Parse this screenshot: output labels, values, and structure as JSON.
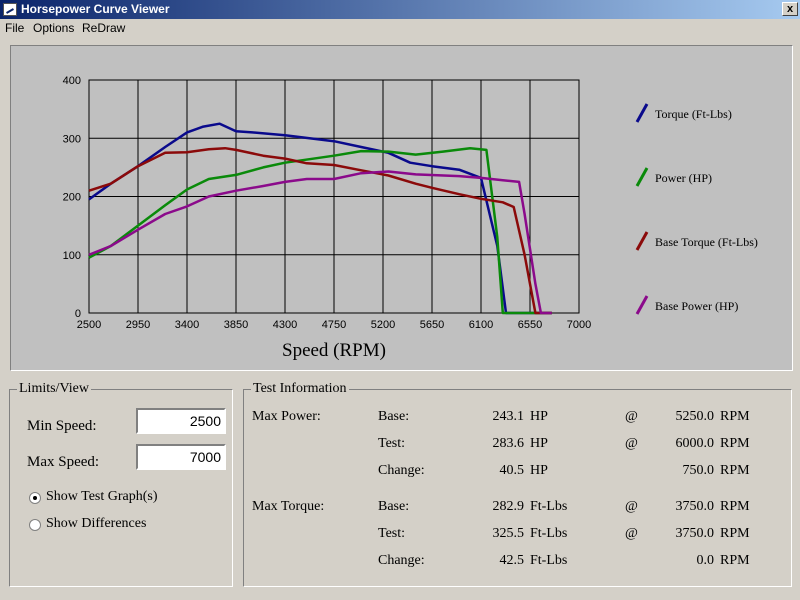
{
  "window": {
    "title": "Horsepower Curve Viewer",
    "close_label": "x"
  },
  "menu": [
    "File",
    "Options",
    "ReDraw"
  ],
  "chart_data": {
    "type": "line",
    "xlabel": "Speed (RPM)",
    "ylabel": "",
    "xlim": [
      2500,
      7000
    ],
    "ylim": [
      0,
      400
    ],
    "x_ticks": [
      2500,
      2950,
      3400,
      3850,
      4300,
      4750,
      5200,
      5650,
      6100,
      6550,
      7000
    ],
    "y_ticks": [
      0,
      100,
      200,
      300,
      400
    ],
    "grid": true,
    "legend_position": "right",
    "series": [
      {
        "name": "Torque (Ft-Lbs)",
        "color": "#0a0a8c",
        "points": [
          [
            2500,
            195
          ],
          [
            2700,
            222
          ],
          [
            2950,
            252
          ],
          [
            3200,
            285
          ],
          [
            3400,
            310
          ],
          [
            3550,
            320
          ],
          [
            3700,
            325
          ],
          [
            3850,
            312
          ],
          [
            4000,
            310
          ],
          [
            4300,
            305
          ],
          [
            4750,
            295
          ],
          [
            5000,
            285
          ],
          [
            5250,
            275
          ],
          [
            5450,
            258
          ],
          [
            5650,
            252
          ],
          [
            5900,
            246
          ],
          [
            6100,
            232
          ],
          [
            6250,
            115
          ],
          [
            6330,
            0
          ],
          [
            6550,
            0
          ],
          [
            6750,
            0
          ]
        ]
      },
      {
        "name": "Power (HP)",
        "color": "#0a8a0a",
        "points": [
          [
            2500,
            95
          ],
          [
            2700,
            115
          ],
          [
            2950,
            150
          ],
          [
            3200,
            185
          ],
          [
            3400,
            212
          ],
          [
            3600,
            230
          ],
          [
            3850,
            237
          ],
          [
            4100,
            250
          ],
          [
            4300,
            258
          ],
          [
            4750,
            270
          ],
          [
            5000,
            278
          ],
          [
            5250,
            277
          ],
          [
            5500,
            272
          ],
          [
            5750,
            277
          ],
          [
            6000,
            283
          ],
          [
            6150,
            280
          ],
          [
            6250,
            130
          ],
          [
            6300,
            0
          ],
          [
            6550,
            0
          ],
          [
            6750,
            0
          ]
        ]
      },
      {
        "name": "Base Torque (Ft-Lbs)",
        "color": "#8b0a0a",
        "points": [
          [
            2500,
            210
          ],
          [
            2700,
            222
          ],
          [
            2950,
            252
          ],
          [
            3200,
            275
          ],
          [
            3400,
            276
          ],
          [
            3600,
            281
          ],
          [
            3750,
            283
          ],
          [
            3850,
            280
          ],
          [
            4100,
            270
          ],
          [
            4300,
            265
          ],
          [
            4500,
            257
          ],
          [
            4750,
            254
          ],
          [
            5000,
            245
          ],
          [
            5250,
            236
          ],
          [
            5500,
            222
          ],
          [
            5650,
            215
          ],
          [
            5900,
            204
          ],
          [
            6100,
            196
          ],
          [
            6300,
            190
          ],
          [
            6400,
            182
          ],
          [
            6500,
            100
          ],
          [
            6600,
            0
          ],
          [
            6750,
            0
          ]
        ]
      },
      {
        "name": "Base Power (HP)",
        "color": "#8b0a8b",
        "points": [
          [
            2500,
            100
          ],
          [
            2700,
            115
          ],
          [
            2950,
            143
          ],
          [
            3200,
            170
          ],
          [
            3400,
            183
          ],
          [
            3600,
            200
          ],
          [
            3850,
            210
          ],
          [
            4100,
            218
          ],
          [
            4300,
            225
          ],
          [
            4500,
            230
          ],
          [
            4750,
            230
          ],
          [
            5000,
            240
          ],
          [
            5250,
            243
          ],
          [
            5500,
            238
          ],
          [
            5900,
            235
          ],
          [
            6100,
            232
          ],
          [
            6300,
            228
          ],
          [
            6450,
            225
          ],
          [
            6500,
            170
          ],
          [
            6600,
            50
          ],
          [
            6650,
            0
          ],
          [
            6750,
            0
          ]
        ]
      }
    ]
  },
  "limits": {
    "title": "Limits/View",
    "min_label": "Min Speed:",
    "min_value": "2500",
    "max_label": "Max Speed:",
    "max_value": "7000",
    "radio1": "Show Test Graph(s)",
    "radio2": "Show Differences",
    "selected": "radio1"
  },
  "test_info": {
    "title": "Test Information",
    "sections": [
      {
        "label": "Max Power:",
        "rows": [
          {
            "name": "Base:",
            "value": "243.1",
            "unit": "HP",
            "at": "@",
            "rpm": "5250.0",
            "rpm_unit": "RPM"
          },
          {
            "name": "Test:",
            "value": "283.6",
            "unit": "HP",
            "at": "@",
            "rpm": "6000.0",
            "rpm_unit": "RPM"
          },
          {
            "name": "Change:",
            "value": "40.5",
            "unit": "HP",
            "at": "",
            "rpm": "750.0",
            "rpm_unit": "RPM"
          }
        ]
      },
      {
        "label": "Max Torque:",
        "rows": [
          {
            "name": "Base:",
            "value": "282.9",
            "unit": "Ft-Lbs",
            "at": "@",
            "rpm": "3750.0",
            "rpm_unit": "RPM"
          },
          {
            "name": "Test:",
            "value": "325.5",
            "unit": "Ft-Lbs",
            "at": "@",
            "rpm": "3750.0",
            "rpm_unit": "RPM"
          },
          {
            "name": "Change:",
            "value": "42.5",
            "unit": "Ft-Lbs",
            "at": "",
            "rpm": "0.0",
            "rpm_unit": "RPM"
          }
        ]
      }
    ]
  }
}
